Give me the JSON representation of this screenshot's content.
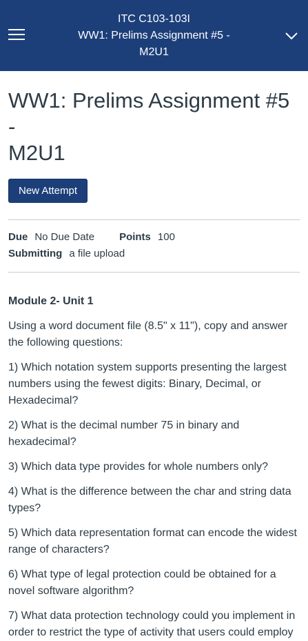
{
  "header": {
    "course": "ITC C103-103I",
    "title_line1": "WW1: Prelims Assignment #5 -",
    "title_line2": "M2U1"
  },
  "page": {
    "title_line1": "WW1: Prelims Assignment #5 -",
    "title_line2": "M2U1",
    "new_attempt": "New Attempt"
  },
  "meta": {
    "due_label": "Due",
    "due_value": "No Due Date",
    "points_label": "Points",
    "points_value": "100",
    "submitting_label": "Submitting",
    "submitting_value": "a file upload"
  },
  "content": {
    "heading": "Module 2- Unit 1",
    "intro": "Using  a word document file (8.5\" x 11\"), copy and answer the following questions:",
    "questions": [
      "1) Which notation system supports presenting the largest numbers using the fewest digits: Binary, Decimal, or Hexadecimal?",
      "2) What is the decimal number 75 in binary and hexadecimal?",
      "3) Which data type provides for whole numbers only?",
      "4) What is the difference between the char and string data types?",
      "5) Which data representation format can encode the widest range of characters?",
      "6) What type of legal protection could be obtained for a novel software algorithm?",
      "7) What data protection technology could you implement in order to restrict the type of activity that users could employ"
    ]
  },
  "colors": {
    "header_bg": "#1c3f7a",
    "button_bg": "#1c3f7a",
    "text": "#2d3b45",
    "divider": "#c7cdd1"
  },
  "icons": {
    "menu": "hamburger-icon",
    "expand": "chevron-down-icon"
  }
}
